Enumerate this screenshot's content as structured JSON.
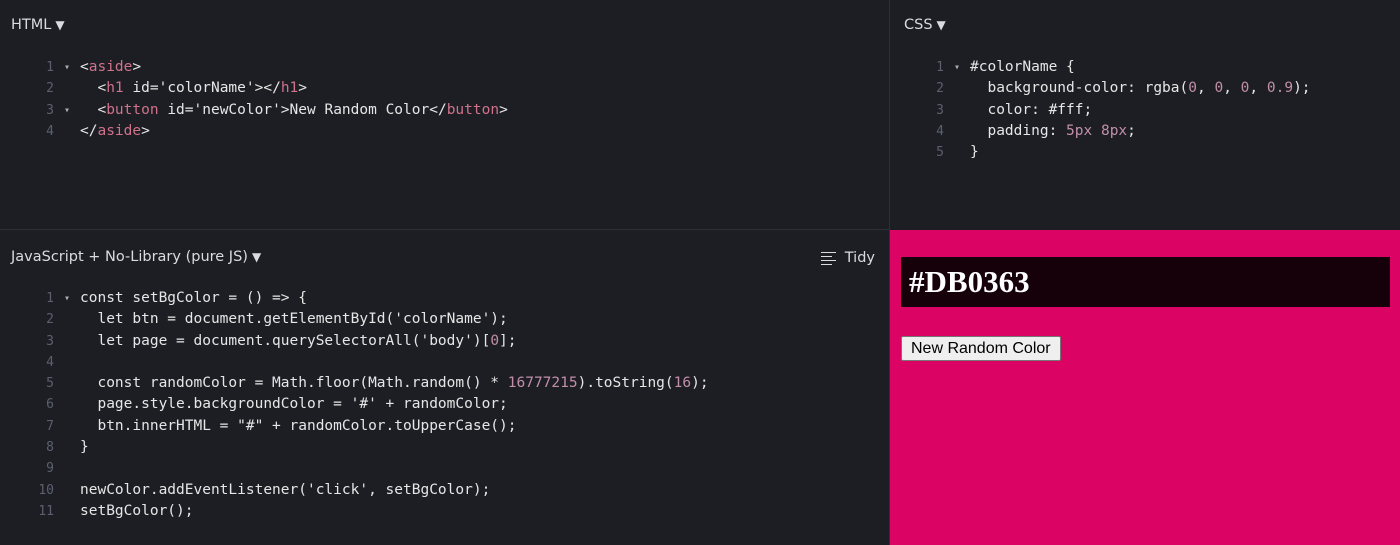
{
  "html_panel": {
    "title": "HTML",
    "lines": [
      {
        "num": "1",
        "fold": "▾",
        "text": "<aside>"
      },
      {
        "num": "2",
        "fold": "",
        "text": "  <h1 id='colorName'></h1>"
      },
      {
        "num": "3",
        "fold": "▾",
        "text": "  <button id='newColor'>New Random Color</button>"
      },
      {
        "num": "4",
        "fold": "",
        "text": "</aside>"
      }
    ]
  },
  "css_panel": {
    "title": "CSS",
    "lines": [
      {
        "num": "1",
        "fold": "▾",
        "text": "#colorName {"
      },
      {
        "num": "2",
        "fold": "",
        "text": "  background-color: rgba(0, 0, 0, 0.9);"
      },
      {
        "num": "3",
        "fold": "",
        "text": "  color: #fff;"
      },
      {
        "num": "4",
        "fold": "",
        "text": "  padding: 5px 8px;"
      },
      {
        "num": "5",
        "fold": "",
        "text": "}"
      }
    ]
  },
  "js_panel": {
    "title": "JavaScript + No-Library (pure JS)",
    "tidy_label": "Tidy",
    "lines": [
      {
        "num": "1",
        "fold": "▾",
        "text": "const setBgColor = () => {"
      },
      {
        "num": "2",
        "fold": "",
        "text": "  let btn = document.getElementById('colorName');"
      },
      {
        "num": "3",
        "fold": "",
        "text": "  let page = document.querySelectorAll('body')[0];"
      },
      {
        "num": "4",
        "fold": "",
        "text": ""
      },
      {
        "num": "5",
        "fold": "",
        "text": "  const randomColor = Math.floor(Math.random() * 16777215).toString(16);"
      },
      {
        "num": "6",
        "fold": "",
        "text": "  page.style.backgroundColor = '#' + randomColor;"
      },
      {
        "num": "7",
        "fold": "",
        "text": "  btn.innerHTML = \"#\" + randomColor.toUpperCase();"
      },
      {
        "num": "8",
        "fold": "",
        "text": "}"
      },
      {
        "num": "9",
        "fold": "",
        "text": ""
      },
      {
        "num": "10",
        "fold": "",
        "text": "newColor.addEventListener('click', setBgColor);"
      },
      {
        "num": "11",
        "fold": "",
        "text": "setBgColor();"
      }
    ]
  },
  "result": {
    "color_name": "#DB0363",
    "button_label": "New Random Color",
    "background": "#db0363"
  },
  "colors": {
    "editor_bg": "#1c1e24",
    "tag": "#d0728a",
    "number": "#c28ea9",
    "line_number": "#5c606e"
  }
}
